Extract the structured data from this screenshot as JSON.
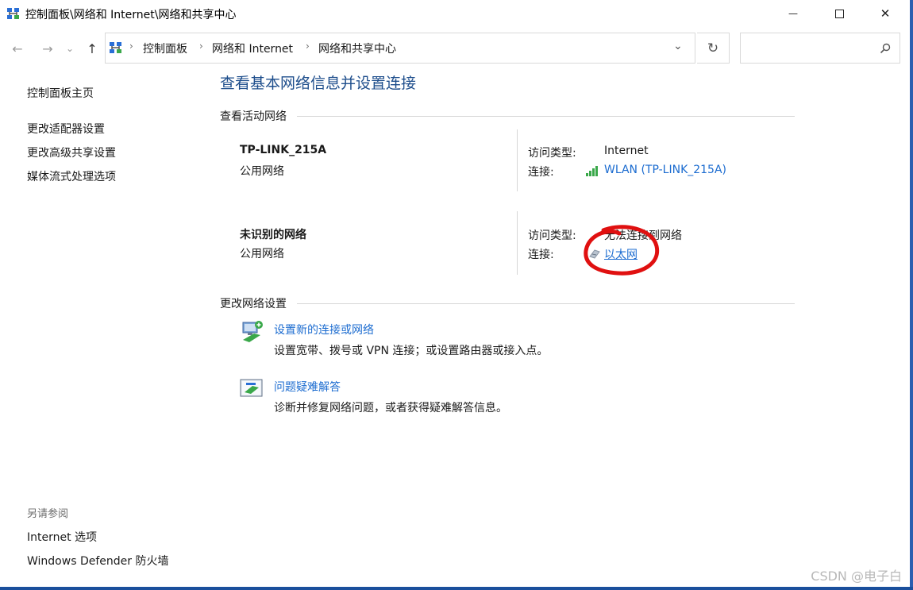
{
  "window": {
    "title": "控制面板\\网络和 Internet\\网络和共享中心",
    "minimize_glyph": "—",
    "maximize_glyph": "☐",
    "close_glyph": "✕"
  },
  "nav": {
    "back_glyph": "←",
    "forward_glyph": "→",
    "history_glyph": "⌄",
    "up_glyph": "↑",
    "breadcrumb": [
      "控制面板",
      "网络和 Internet",
      "网络和共享中心"
    ],
    "sep_glyph": "›",
    "dropdown_glyph": "⌄",
    "refresh_glyph": "↻",
    "search_value": ""
  },
  "sidebar": {
    "home": "控制面板主页",
    "links": [
      "更改适配器设置",
      "更改高级共享设置",
      "媒体流式处理选项"
    ],
    "see_also_label": "另请参阅",
    "see_also": [
      "Internet 选项",
      "Windows Defender 防火墙"
    ]
  },
  "main": {
    "title": "查看基本网络信息并设置连接",
    "active_networks_label": "查看活动网络",
    "networks": [
      {
        "name": "TP-LINK_215A",
        "type": "公用网络",
        "access_label": "访问类型:",
        "access_value": "Internet",
        "connection_label": "连接:",
        "connection_value": "WLAN (TP-LINK_215A)"
      },
      {
        "name": "未识别的网络",
        "type": "公用网络",
        "access_label": "访问类型:",
        "access_value": "无法连接到网络",
        "connection_label": "连接:",
        "connection_value": "以太网"
      }
    ],
    "change_settings_label": "更改网络设置",
    "tasks": [
      {
        "title": "设置新的连接或网络",
        "desc": "设置宽带、拨号或 VPN 连接；或设置路由器或接入点。"
      },
      {
        "title": "问题疑难解答",
        "desc": "诊断并修复网络问题，或者获得疑难解答信息。"
      }
    ]
  },
  "watermark": "CSDN @电子白",
  "colors": {
    "link": "#1c6cd0",
    "title": "#1e4e8c",
    "annotation": "#e01010"
  }
}
